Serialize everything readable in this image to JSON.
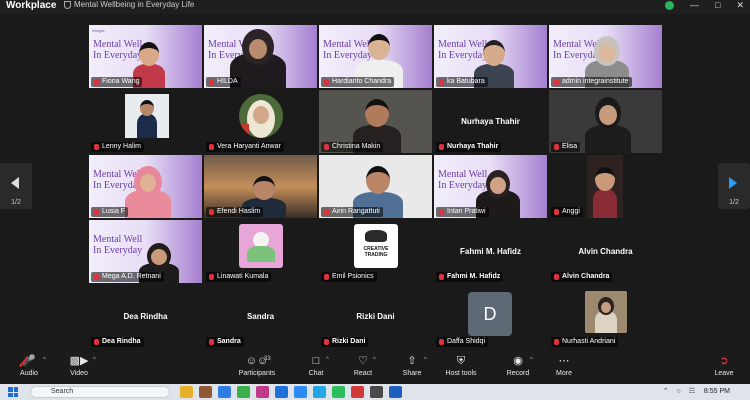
{
  "titlebar": {
    "app_name": "Workplace",
    "meeting_title": "Mental Wellbeing in Everyday Life"
  },
  "slide": {
    "line1": "Mental Well",
    "line2": "In Everyday"
  },
  "participants": [
    {
      "name": "Fiona Wang"
    },
    {
      "name": "HILDA"
    },
    {
      "name": "Hardianto Chandra"
    },
    {
      "name": "ka Batubara"
    },
    {
      "name": "admin integrainstitute"
    },
    {
      "name": "Lenny Halim"
    },
    {
      "name": "Vera Haryanti Anwar"
    },
    {
      "name": "Christina Makin"
    },
    {
      "name": "Nurhaya Thahir",
      "display": "Nurhaya Thahir"
    },
    {
      "name": "Elisa"
    },
    {
      "name": "Lusia F"
    },
    {
      "name": "Efendi Haslim"
    },
    {
      "name": "Airin Rangattuti"
    },
    {
      "name": "Intan Pratiwi"
    },
    {
      "name": "Anggi"
    },
    {
      "name": "Mega A.D. Retnani"
    },
    {
      "name": "Linawati Kumala"
    },
    {
      "name": "Emil Psionics"
    },
    {
      "name": "Fahmi M. Hafidz",
      "display": "Fahmi M. Hafidz"
    },
    {
      "name": "Alvin Chandra",
      "display": "Alvin Chandra"
    },
    {
      "name": "Dea Rindha",
      "display": "Dea Rindha"
    },
    {
      "name": "Sandra",
      "display": "Sandra"
    },
    {
      "name": "Rizki Dani",
      "display": "Rizki Dani"
    },
    {
      "name": "Daffa Shidqi",
      "avatar_letter": "D"
    },
    {
      "name": "Nurhasti Andriani"
    }
  ],
  "logo_card": {
    "line1": "CREATIVE",
    "line2": "TRADING"
  },
  "pager": {
    "left": "1/2",
    "right": "1/2"
  },
  "toolbar": {
    "audio": "Audio",
    "video": "Video",
    "participants": "Participants",
    "participants_count": "33",
    "chat": "Chat",
    "react": "React",
    "share": "Share",
    "host_tools": "Host tools",
    "record": "Record",
    "more": "More",
    "leave": "Leave"
  },
  "taskbar": {
    "search_placeholder": "Search",
    "time": "8:55 PM"
  },
  "colors": {
    "active_border": "#23d160",
    "leave_red": "#e0323c",
    "accent_blue": "#2b9cf2"
  }
}
